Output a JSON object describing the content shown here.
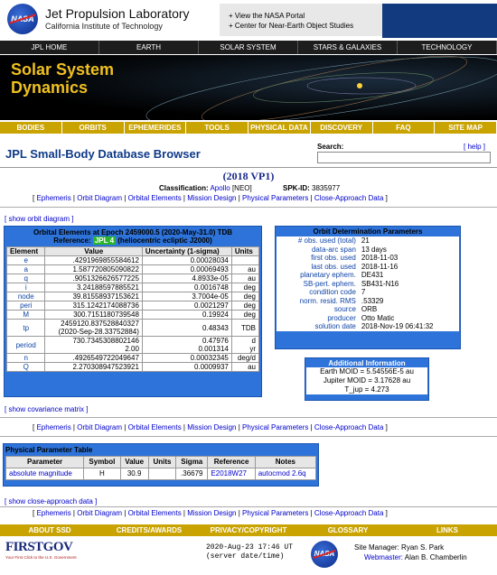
{
  "header": {
    "org_title": "Jet Propulsion Laboratory",
    "org_subtitle": "California Institute of Technology",
    "nasa_logo_text": "NASA",
    "links": [
      "+ View the NASA Portal",
      "+ Center for Near-Earth Object Studies"
    ]
  },
  "nav": [
    "JPL HOME",
    "EARTH",
    "SOLAR SYSTEM",
    "STARS & GALAXIES",
    "TECHNOLOGY"
  ],
  "banner_title": [
    "Solar System",
    "Dynamics"
  ],
  "menu": [
    "BODIES",
    "ORBITS",
    "EPHEMERIDES",
    "TOOLS",
    "PHYSICAL DATA",
    "DISCOVERY",
    "FAQ",
    "SITE MAP"
  ],
  "page_title": "JPL Small-Body Database Browser",
  "search": {
    "label": "Search:",
    "value": "",
    "help": "[ help ]"
  },
  "object": {
    "name": "(2018 VP1)",
    "classification_label": "Classification:",
    "classification": "Apollo",
    "classification_code": "[NEO]",
    "spkid_label": "SPK-ID:",
    "spkid": "3835977"
  },
  "section_links": [
    "Ephemeris",
    "Orbit Diagram",
    "Orbital Elements",
    "Mission Design",
    "Physical Parameters",
    "Close-Approach Data"
  ],
  "show_orbit_diagram": "[ show orbit diagram ]",
  "orbital_elements": {
    "title": "Orbital Elements at Epoch 2459000.5 (2020-May-31.0) TDB",
    "reference_label": "Reference:",
    "reference": "JPL 4",
    "reference_note": "(heliocentric ecliptic J2000)",
    "headers": [
      "Element",
      "Value",
      "Uncertainty (1-sigma)",
      "Units"
    ],
    "rows": [
      [
        "e",
        ".4291969855584612",
        "0.00028034",
        ""
      ],
      [
        "a",
        "1.587720805090822",
        "0.00069493",
        "au"
      ],
      [
        "q",
        ".9051326626577225",
        "4.8933e-05",
        "au"
      ],
      [
        "i",
        "3.24188597885521",
        "0.0016748",
        "deg"
      ],
      [
        "node",
        "39.81558937153621",
        "3.7004e-05",
        "deg"
      ],
      [
        "peri",
        "315.1242174088736",
        "0.0021297",
        "deg"
      ],
      [
        "M",
        "300.7151180739548",
        "0.19924",
        "deg"
      ],
      [
        "tp",
        "2459120.837528840327\n(2020-Sep-28.33752884)",
        "0.48343",
        "TDB"
      ],
      [
        "period",
        "730.7345308802146\n2.00",
        "0.47976\n0.001314",
        "d\nyr"
      ],
      [
        "n",
        ".4926549722049647",
        "0.00032345",
        "deg/d"
      ],
      [
        "Q",
        "2.270308947523921",
        "0.0009937",
        "au"
      ]
    ]
  },
  "orbit_determination": {
    "title": "Orbit Determination Parameters",
    "rows": [
      [
        "# obs. used (total)",
        "21"
      ],
      [
        "data-arc span",
        "13 days"
      ],
      [
        "first obs. used",
        "2018-11-03"
      ],
      [
        "last obs. used",
        "2018-11-16"
      ],
      [
        "planetary ephem.",
        "DE431"
      ],
      [
        "SB-pert. ephem.",
        "SB431-N16"
      ],
      [
        "condition code",
        "7"
      ],
      [
        "norm. resid. RMS",
        ".53329"
      ],
      [
        "source",
        "ORB"
      ],
      [
        "producer",
        "Otto Matic"
      ],
      [
        "solution date",
        "2018-Nov-19 06:41:32"
      ]
    ]
  },
  "additional_info": {
    "title": "Additional Information",
    "earth_moid": "Earth MOID = 5.54556E-5 au",
    "jupiter_moid": "Jupiter MOID = 3.17628 au",
    "tjup": "T_jup = 4.273"
  },
  "show_covariance": "[ show covariance matrix ]",
  "physical": {
    "title": "Physical Parameter Table",
    "headers": [
      "Parameter",
      "Symbol",
      "Value",
      "Units",
      "Sigma",
      "Reference",
      "Notes"
    ],
    "rows": [
      [
        "absolute magnitude",
        "H",
        "30.9",
        "",
        ".36679",
        "E2018W27",
        "autocmod 2.6q"
      ]
    ]
  },
  "show_close_approach": "[ show close-approach data ]",
  "footer_menu": [
    "ABOUT SSD",
    "CREDITS/AWARDS",
    "PRIVACY/COPYRIGHT",
    "GLOSSARY",
    "LINKS"
  ],
  "footer": {
    "firstgov": "FIRSTGOV",
    "firstgov_tag": "Your First Click to the U.S. Government",
    "server_date": "2020-Aug-23 17:46 UT",
    "server_note": "(server date/time)",
    "site_manager_label": "Site Manager:",
    "site_manager": "Ryan S. Park",
    "webmaster_label": "Webmaster:",
    "webmaster": "Alan B. Chamberlin"
  }
}
